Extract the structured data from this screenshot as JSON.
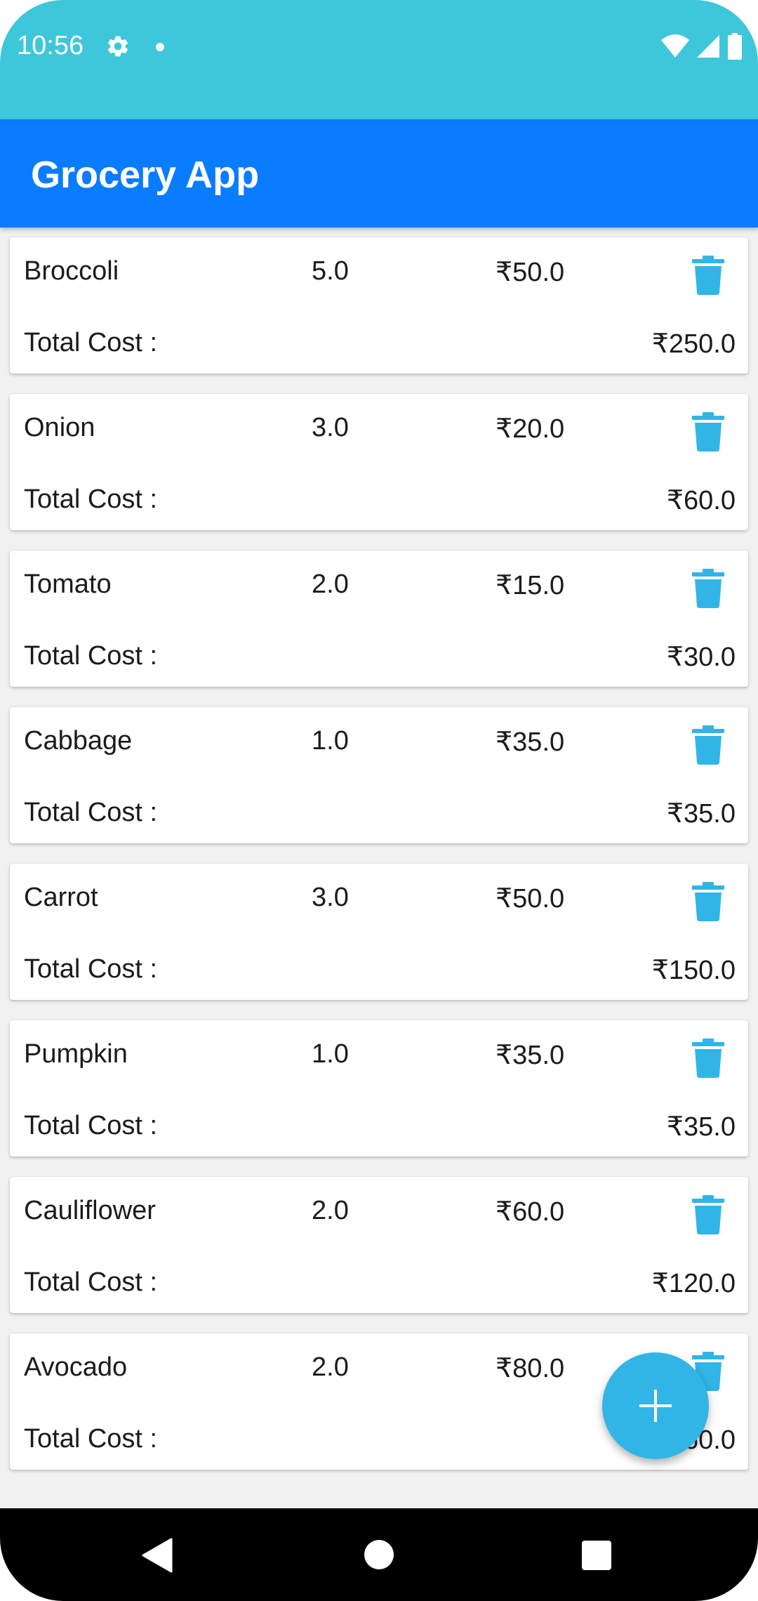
{
  "status_bar": {
    "time": "10:56"
  },
  "app_bar": {
    "title": "Grocery App"
  },
  "items": [
    {
      "name": "Broccoli",
      "quantity": "5.0",
      "price": "₹50.0",
      "total_label": "Total Cost :",
      "total": "₹250.0"
    },
    {
      "name": "Onion",
      "quantity": "3.0",
      "price": "₹20.0",
      "total_label": "Total Cost :",
      "total": "₹60.0"
    },
    {
      "name": "Tomato",
      "quantity": "2.0",
      "price": "₹15.0",
      "total_label": "Total Cost :",
      "total": "₹30.0"
    },
    {
      "name": "Cabbage",
      "quantity": "1.0",
      "price": "₹35.0",
      "total_label": "Total Cost :",
      "total": "₹35.0"
    },
    {
      "name": "Carrot",
      "quantity": "3.0",
      "price": "₹50.0",
      "total_label": "Total Cost :",
      "total": "₹150.0"
    },
    {
      "name": "Pumpkin",
      "quantity": "1.0",
      "price": "₹35.0",
      "total_label": "Total Cost :",
      "total": "₹35.0"
    },
    {
      "name": "Cauliflower",
      "quantity": "2.0",
      "price": "₹60.0",
      "total_label": "Total Cost :",
      "total": "₹120.0"
    },
    {
      "name": "Avocado",
      "quantity": "2.0",
      "price": "₹80.0",
      "total_label": "Total Cost :",
      "total": "₹160.0"
    }
  ],
  "icons": {
    "delete": "trash-icon",
    "fab": "plus-icon"
  },
  "colors": {
    "status_bar": "#3ec7db",
    "app_bar": "#0a7cff",
    "accent": "#31b5e6"
  }
}
